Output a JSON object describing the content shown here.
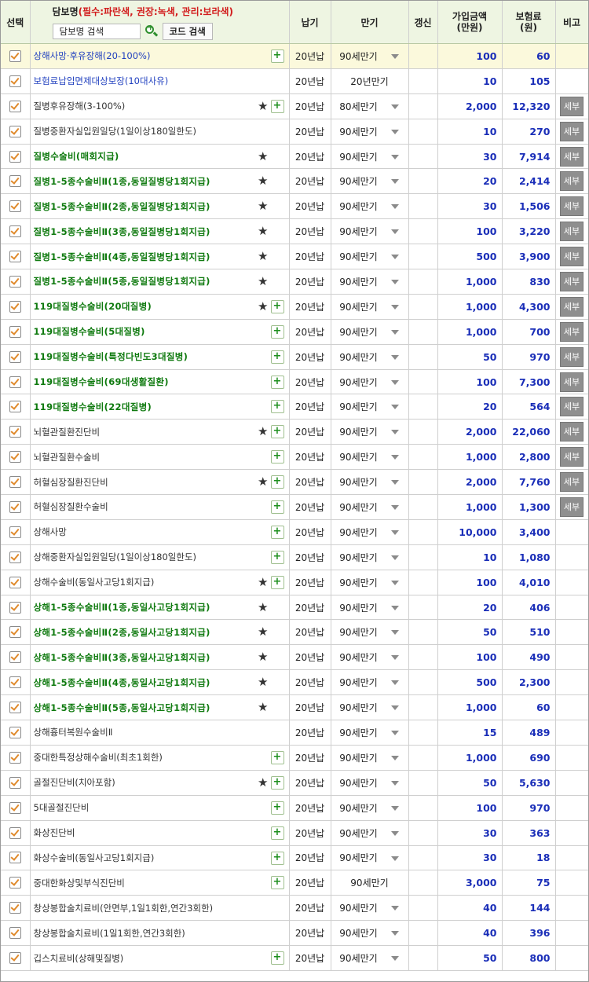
{
  "header": {
    "select": "선택",
    "coverage_name": "담보명",
    "legend": "(필수:파란색, 권장:녹색, 관리:보라색)",
    "search_placeholder": "담보명 검색",
    "code_search": "코드 검색",
    "payment_period": "납기",
    "maturity": "만기",
    "renewal": "갱신",
    "insured_amount": "가입금액\n(만원)",
    "premium": "보험료\n(원)",
    "note": "비고"
  },
  "detail_label": "세부",
  "rows": [
    {
      "name": "상해사망·후유장해(20-100%)",
      "color": "blue",
      "star": false,
      "plus": true,
      "pay": "20년납",
      "maturity": "90세만기",
      "dropdown": true,
      "amount": "100",
      "premium": "60",
      "detail": false,
      "highlight": true
    },
    {
      "name": "보험료납입면제대상보장(10대사유)",
      "color": "blue",
      "star": false,
      "plus": false,
      "pay": "20년납",
      "maturity": "20년만기",
      "dropdown": false,
      "amount": "10",
      "premium": "105",
      "detail": false
    },
    {
      "name": "질병후유장해(3-100%)",
      "color": "black",
      "star": true,
      "plus": true,
      "pay": "20년납",
      "maturity": "80세만기",
      "dropdown": true,
      "amount": "2,000",
      "premium": "12,320",
      "detail": true
    },
    {
      "name": "질병중환자실입원일당(1일이상180일한도)",
      "color": "black",
      "star": false,
      "plus": false,
      "pay": "20년납",
      "maturity": "90세만기",
      "dropdown": true,
      "amount": "10",
      "premium": "270",
      "detail": true
    },
    {
      "name": "질병수술비(매회지급)",
      "color": "green",
      "star": true,
      "plus": false,
      "pay": "20년납",
      "maturity": "90세만기",
      "dropdown": true,
      "amount": "30",
      "premium": "7,914",
      "detail": true
    },
    {
      "name": "질병1-5종수술비Ⅱ(1종,동일질병당1회지급)",
      "color": "green",
      "star": true,
      "plus": false,
      "pay": "20년납",
      "maturity": "90세만기",
      "dropdown": true,
      "amount": "20",
      "premium": "2,414",
      "detail": true
    },
    {
      "name": "질병1-5종수술비Ⅱ(2종,동일질병당1회지급)",
      "color": "green",
      "star": true,
      "plus": false,
      "pay": "20년납",
      "maturity": "90세만기",
      "dropdown": true,
      "amount": "30",
      "premium": "1,506",
      "detail": true
    },
    {
      "name": "질병1-5종수술비Ⅱ(3종,동일질병당1회지급)",
      "color": "green",
      "star": true,
      "plus": false,
      "pay": "20년납",
      "maturity": "90세만기",
      "dropdown": true,
      "amount": "100",
      "premium": "3,220",
      "detail": true
    },
    {
      "name": "질병1-5종수술비Ⅱ(4종,동일질병당1회지급)",
      "color": "green",
      "star": true,
      "plus": false,
      "pay": "20년납",
      "maturity": "90세만기",
      "dropdown": true,
      "amount": "500",
      "premium": "3,900",
      "detail": true
    },
    {
      "name": "질병1-5종수술비Ⅱ(5종,동일질병당1회지급)",
      "color": "green",
      "star": true,
      "plus": false,
      "pay": "20년납",
      "maturity": "90세만기",
      "dropdown": true,
      "amount": "1,000",
      "premium": "830",
      "detail": true
    },
    {
      "name": "119대질병수술비(20대질병)",
      "color": "green",
      "star": true,
      "plus": true,
      "pay": "20년납",
      "maturity": "90세만기",
      "dropdown": true,
      "amount": "1,000",
      "premium": "4,300",
      "detail": true
    },
    {
      "name": "119대질병수술비(5대질병)",
      "color": "green",
      "star": false,
      "plus": true,
      "pay": "20년납",
      "maturity": "90세만기",
      "dropdown": true,
      "amount": "1,000",
      "premium": "700",
      "detail": true
    },
    {
      "name": "119대질병수술비(특정다빈도3대질병)",
      "color": "green",
      "star": false,
      "plus": true,
      "pay": "20년납",
      "maturity": "90세만기",
      "dropdown": true,
      "amount": "50",
      "premium": "970",
      "detail": true
    },
    {
      "name": "119대질병수술비(69대생활질환)",
      "color": "green",
      "star": false,
      "plus": true,
      "pay": "20년납",
      "maturity": "90세만기",
      "dropdown": true,
      "amount": "100",
      "premium": "7,300",
      "detail": true
    },
    {
      "name": "119대질병수술비(22대질병)",
      "color": "green",
      "star": false,
      "plus": true,
      "pay": "20년납",
      "maturity": "90세만기",
      "dropdown": true,
      "amount": "20",
      "premium": "564",
      "detail": true
    },
    {
      "name": "뇌혈관질환진단비",
      "color": "black",
      "star": true,
      "plus": true,
      "pay": "20년납",
      "maturity": "90세만기",
      "dropdown": true,
      "amount": "2,000",
      "premium": "22,060",
      "detail": true
    },
    {
      "name": "뇌혈관질환수술비",
      "color": "black",
      "star": false,
      "plus": true,
      "pay": "20년납",
      "maturity": "90세만기",
      "dropdown": true,
      "amount": "1,000",
      "premium": "2,800",
      "detail": true
    },
    {
      "name": "허혈심장질환진단비",
      "color": "black",
      "star": true,
      "plus": true,
      "pay": "20년납",
      "maturity": "90세만기",
      "dropdown": true,
      "amount": "2,000",
      "premium": "7,760",
      "detail": true
    },
    {
      "name": "허혈심장질환수술비",
      "color": "black",
      "star": false,
      "plus": true,
      "pay": "20년납",
      "maturity": "90세만기",
      "dropdown": true,
      "amount": "1,000",
      "premium": "1,300",
      "detail": true
    },
    {
      "name": "상해사망",
      "color": "black",
      "star": false,
      "plus": true,
      "pay": "20년납",
      "maturity": "90세만기",
      "dropdown": true,
      "amount": "10,000",
      "premium": "3,400",
      "detail": false
    },
    {
      "name": "상해중환자실입원일당(1일이상180일한도)",
      "color": "black",
      "star": false,
      "plus": true,
      "pay": "20년납",
      "maturity": "90세만기",
      "dropdown": true,
      "amount": "10",
      "premium": "1,080",
      "detail": false
    },
    {
      "name": "상해수술비(동일사고당1회지급)",
      "color": "black",
      "star": true,
      "plus": true,
      "pay": "20년납",
      "maturity": "90세만기",
      "dropdown": true,
      "amount": "100",
      "premium": "4,010",
      "detail": false
    },
    {
      "name": "상해1-5종수술비Ⅱ(1종,동일사고당1회지급)",
      "color": "green",
      "star": true,
      "plus": false,
      "pay": "20년납",
      "maturity": "90세만기",
      "dropdown": true,
      "amount": "20",
      "premium": "406",
      "detail": false
    },
    {
      "name": "상해1-5종수술비Ⅱ(2종,동일사고당1회지급)",
      "color": "green",
      "star": true,
      "plus": false,
      "pay": "20년납",
      "maturity": "90세만기",
      "dropdown": true,
      "amount": "50",
      "premium": "510",
      "detail": false
    },
    {
      "name": "상해1-5종수술비Ⅱ(3종,동일사고당1회지급)",
      "color": "green",
      "star": true,
      "plus": false,
      "pay": "20년납",
      "maturity": "90세만기",
      "dropdown": true,
      "amount": "100",
      "premium": "490",
      "detail": false
    },
    {
      "name": "상해1-5종수술비Ⅱ(4종,동일사고당1회지급)",
      "color": "green",
      "star": true,
      "plus": false,
      "pay": "20년납",
      "maturity": "90세만기",
      "dropdown": true,
      "amount": "500",
      "premium": "2,300",
      "detail": false
    },
    {
      "name": "상해1-5종수술비Ⅱ(5종,동일사고당1회지급)",
      "color": "green",
      "star": true,
      "plus": false,
      "pay": "20년납",
      "maturity": "90세만기",
      "dropdown": true,
      "amount": "1,000",
      "premium": "60",
      "detail": false
    },
    {
      "name": "상해흉터복원수술비Ⅱ",
      "color": "black",
      "star": false,
      "plus": false,
      "pay": "20년납",
      "maturity": "90세만기",
      "dropdown": true,
      "amount": "15",
      "premium": "489",
      "detail": false
    },
    {
      "name": "중대한특정상해수술비(최초1회한)",
      "color": "black",
      "star": false,
      "plus": true,
      "pay": "20년납",
      "maturity": "90세만기",
      "dropdown": true,
      "amount": "1,000",
      "premium": "690",
      "detail": false
    },
    {
      "name": "골절진단비(치아포함)",
      "color": "black",
      "star": true,
      "plus": true,
      "pay": "20년납",
      "maturity": "90세만기",
      "dropdown": true,
      "amount": "50",
      "premium": "5,630",
      "detail": false
    },
    {
      "name": "5대골절진단비",
      "color": "black",
      "star": false,
      "plus": true,
      "pay": "20년납",
      "maturity": "90세만기",
      "dropdown": true,
      "amount": "100",
      "premium": "970",
      "detail": false
    },
    {
      "name": "화상진단비",
      "color": "black",
      "star": false,
      "plus": true,
      "pay": "20년납",
      "maturity": "90세만기",
      "dropdown": true,
      "amount": "30",
      "premium": "363",
      "detail": false
    },
    {
      "name": "화상수술비(동일사고당1회지급)",
      "color": "black",
      "star": false,
      "plus": true,
      "pay": "20년납",
      "maturity": "90세만기",
      "dropdown": true,
      "amount": "30",
      "premium": "18",
      "detail": false
    },
    {
      "name": "중대한화상및부식진단비",
      "color": "black",
      "star": false,
      "plus": true,
      "pay": "20년납",
      "maturity": "90세만기",
      "dropdown": false,
      "amount": "3,000",
      "premium": "75",
      "detail": false
    },
    {
      "name": "창상봉합술치료비(안면부,1일1회한,연간3회한)",
      "color": "black",
      "star": false,
      "plus": false,
      "pay": "20년납",
      "maturity": "90세만기",
      "dropdown": true,
      "amount": "40",
      "premium": "144",
      "detail": false
    },
    {
      "name": "창상봉합술치료비(1일1회한,연간3회한)",
      "color": "black",
      "star": false,
      "plus": false,
      "pay": "20년납",
      "maturity": "90세만기",
      "dropdown": true,
      "amount": "40",
      "premium": "396",
      "detail": false
    },
    {
      "name": "깁스치료비(상해및질병)",
      "color": "black",
      "star": false,
      "plus": true,
      "pay": "20년납",
      "maturity": "90세만기",
      "dropdown": true,
      "amount": "50",
      "premium": "800",
      "detail": false
    }
  ]
}
